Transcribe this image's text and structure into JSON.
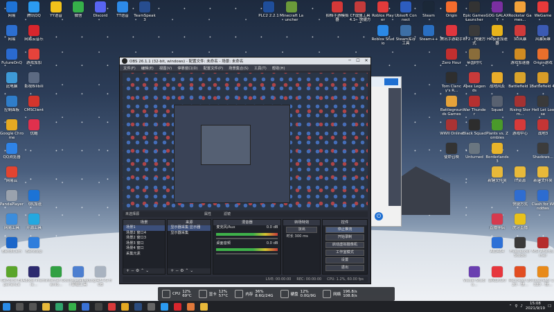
{
  "desktop_icons": [
    {
      "label": "网易",
      "icon": "n-icon",
      "color": "#1e73d6",
      "col": 0,
      "row": 0
    },
    {
      "label": "腾讯QQ",
      "icon": "qq-icon",
      "color": "#2b9bf1",
      "col": 1,
      "row": 0
    },
    {
      "label": "YY语音",
      "icon": "yy-icon",
      "color": "#f2c21b",
      "col": 2,
      "row": 0
    },
    {
      "label": "微信",
      "icon": "wechat-icon",
      "color": "#36b04a",
      "col": 3,
      "row": 0
    },
    {
      "label": "Discord",
      "icon": "discord-icon",
      "color": "#5865f2",
      "col": 4,
      "row": 0
    },
    {
      "label": "TT语音",
      "icon": "tt-icon",
      "color": "#2d8ae8",
      "col": 5,
      "row": 0
    },
    {
      "label": "TeamSpeak 3",
      "icon": "teamspeak-icon",
      "color": "#274d8f",
      "col": 6,
      "row": 0
    },
    {
      "label": "网易",
      "icon": "n-icon",
      "color": "#2c6fd1",
      "col": 0,
      "row": 1
    },
    {
      "label": "网易云音乐",
      "icon": "music-icon",
      "color": "#d8262d",
      "col": 1,
      "row": 1
    },
    {
      "label": "FutureOnQ",
      "icon": "network-icon",
      "color": "#2a6ad0",
      "col": 0,
      "row": 2
    },
    {
      "label": "游戏加加",
      "icon": "game-icon",
      "color": "#e6433b",
      "col": 1,
      "row": 2
    },
    {
      "label": "此电脑",
      "icon": "pc-icon",
      "color": "#3e9ad7",
      "col": 0,
      "row": 3
    },
    {
      "label": "影视Bilibili",
      "icon": "bili-icon",
      "color": "#5c6a82",
      "col": 1,
      "row": 3
    },
    {
      "label": "控制面板",
      "icon": "panel-icon",
      "color": "#2f7dc9",
      "col": 0,
      "row": 4
    },
    {
      "label": "CMSClient",
      "icon": "cms-icon",
      "color": "#d4352c",
      "col": 1,
      "row": 4
    },
    {
      "label": "Google Chrome",
      "icon": "chrome-icon",
      "color": "#e5a922",
      "col": 0,
      "row": 5
    },
    {
      "label": "优酷",
      "icon": "youku-icon",
      "color": "#e0304d",
      "col": 1,
      "row": 5
    },
    {
      "label": "QQ浏览器",
      "icon": "browser-icon",
      "color": "#2f83e6",
      "col": 0,
      "row": 6
    },
    {
      "label": "网易云",
      "icon": "cloud-icon",
      "color": "#e24430",
      "col": 0,
      "row": 7
    },
    {
      "label": "PandaPlayer",
      "icon": "panda-icon",
      "color": "#9aa2ad",
      "col": 0,
      "row": 8
    },
    {
      "label": "飞机加速",
      "icon": "plane-icon",
      "color": "#1c73d6",
      "col": 1,
      "row": 8
    },
    {
      "label": "网易工具",
      "icon": "tool-icon",
      "color": "#3c8ddc",
      "col": 0,
      "row": 9
    },
    {
      "label": "开源工具",
      "icon": "open-icon",
      "color": "#23a8e0",
      "col": 1,
      "row": 9
    },
    {
      "label": "BandiCam",
      "icon": "rec-icon",
      "color": "#1b66c9",
      "col": 0,
      "row": 10
    },
    {
      "label": "Bandizip",
      "icon": "zip-icon",
      "color": "#2f7edc",
      "col": 1,
      "row": 10
    },
    {
      "label": "GeForce Experience",
      "icon": "nvidia-icon",
      "color": "#5aa52a",
      "col": 0,
      "row": 11
    },
    {
      "label": "Adobe Premie...",
      "icon": "adobe-icon",
      "color": "#2c2a6e",
      "col": 1,
      "row": 11
    },
    {
      "label": "Internet Downlo...",
      "icon": "idm-icon",
      "color": "#31a043",
      "col": 2,
      "row": 11
    },
    {
      "label": "UninstallTool 卸载工具",
      "icon": "uninstall-icon",
      "color": "#4d7fd0",
      "col": 3,
      "row": 11
    },
    {
      "label": "Logi4FT-G HUB",
      "icon": "logi-icon",
      "color": "#a9b3c0",
      "col": 4,
      "row": 11
    },
    {
      "label": "PLC2 2.2.1",
      "icon": "plc-icon",
      "color": "#1f4e9a",
      "col": 10,
      "row": 0
    },
    {
      "label": "Minecraft Launcher",
      "icon": "minecraft-icon",
      "color": "#6b9a3a",
      "col": 11,
      "row": 0
    },
    {
      "label": "拍档手游模拟器",
      "icon": "emu-icon",
      "color": "#d43838",
      "col": 13,
      "row": 0
    },
    {
      "label": "CF战盟工具 4.1 - 快捷方式",
      "icon": "cf-icon",
      "color": "#c43b3b",
      "col": 14,
      "row": 0
    },
    {
      "label": "Roblox Player",
      "icon": "roblox-icon",
      "color": "#e23b3b",
      "col": 15,
      "row": 0
    },
    {
      "label": "Ubisoft Connect",
      "icon": "ubisoft-icon",
      "color": "#2d5dbf",
      "col": 16,
      "row": 0
    },
    {
      "label": "Steam",
      "icon": "steam-icon",
      "color": "#1b2838",
      "col": 17,
      "row": 0
    },
    {
      "label": "Origin",
      "icon": "origin-icon",
      "color": "#f56c2d",
      "col": 18,
      "row": 0
    },
    {
      "label": "Epic Games Launcher",
      "icon": "epic-icon",
      "color": "#333",
      "col": 19,
      "row": 0
    },
    {
      "label": "GOG GALAXY",
      "icon": "gog-icon",
      "color": "#7a2fa0",
      "col": 20,
      "row": 0
    },
    {
      "label": "Rockstar Games...",
      "icon": "rockstar-icon",
      "color": "#f2a23a",
      "col": 21,
      "row": 0
    },
    {
      "label": "WeGame",
      "icon": "wegame-icon",
      "color": "#e83a3a",
      "col": 22,
      "row": 0
    },
    {
      "label": "Roblox Studio",
      "icon": "rstudio-icon",
      "color": "#2b89e6",
      "col": 15,
      "row": 1
    },
    {
      "label": "Steam库存工具",
      "icon": "steam2-icon",
      "color": "#3d6fa5",
      "col": 16,
      "row": 1
    },
    {
      "label": "Steam++",
      "icon": "steampp-icon",
      "color": "#2a6fc1",
      "col": 17,
      "row": 1
    },
    {
      "label": "腾讯手游助手",
      "icon": "tencent-icon",
      "color": "#e0363e",
      "col": 18,
      "row": 1
    },
    {
      "label": "BF2 - 快捷方式",
      "icon": "bf2-icon",
      "color": "#3a3a3a",
      "col": 19,
      "row": 1
    },
    {
      "label": "HK极速加速器",
      "icon": "speed-icon",
      "color": "#e8b31a",
      "col": 20,
      "row": 1
    },
    {
      "label": "3D风暴",
      "icon": "storm-icon",
      "color": "#d03a3a",
      "col": 21,
      "row": 1
    },
    {
      "label": "风暴英雄",
      "icon": "hots-icon",
      "color": "#3b5ab3",
      "col": 22,
      "row": 1
    },
    {
      "label": "Zero Hour",
      "icon": "zh-icon",
      "color": "#c22f2f",
      "col": 18,
      "row": 2
    },
    {
      "label": "帝国时代",
      "icon": "aoe-icon",
      "color": "#8a6d3b",
      "col": 19,
      "row": 2
    },
    {
      "label": "游戏加速器",
      "icon": "acc-icon",
      "color": "#cf8b22",
      "col": 21,
      "row": 2
    },
    {
      "label": "Origin游戏",
      "icon": "origin2-icon",
      "color": "#ea6f2b",
      "col": 22,
      "row": 2
    },
    {
      "label": "Tom Clancy's R...",
      "icon": "r6-icon",
      "color": "#2e2e2e",
      "col": 18,
      "row": 3
    },
    {
      "label": "Apex Legends",
      "icon": "apex-icon",
      "color": "#c73a3a",
      "col": 19,
      "row": 3
    },
    {
      "label": "战地风云",
      "icon": "bf-icon",
      "color": "#e8ac2a",
      "col": 20,
      "row": 3
    },
    {
      "label": "Battlefield 1",
      "icon": "bf1-icon",
      "color": "#d9a32b",
      "col": 21,
      "row": 3
    },
    {
      "label": "Battlefield 4",
      "icon": "bf4-icon",
      "color": "#d89c27",
      "col": 22,
      "row": 3
    },
    {
      "label": "Battlegrounds Games",
      "icon": "pubg-icon",
      "color": "#e6a33a",
      "col": 18,
      "row": 4
    },
    {
      "label": "War Thunder",
      "icon": "wt-icon",
      "color": "#b53030",
      "col": 19,
      "row": 4
    },
    {
      "label": "Squad",
      "icon": "squad-icon",
      "color": "#586170",
      "col": 20,
      "row": 4
    },
    {
      "label": "Rising Storm...",
      "icon": "rs-icon",
      "color": "#a53232",
      "col": 21,
      "row": 4
    },
    {
      "label": "Hell Let Loose",
      "icon": "hll-icon",
      "color": "#3a3a3a",
      "col": 22,
      "row": 4
    },
    {
      "label": "WWII Online",
      "icon": "ww2-icon",
      "color": "#a33",
      "col": 18,
      "row": 5
    },
    {
      "label": "Black Squad",
      "icon": "bs-icon",
      "color": "#2d2d2d",
      "col": 19,
      "row": 5
    },
    {
      "label": "Plants vs. Zombies",
      "icon": "pvz-icon",
      "color": "#4a9a2a",
      "col": 20,
      "row": 5
    },
    {
      "label": "游戏中心",
      "icon": "center-icon",
      "color": "#d73a3a",
      "col": 21,
      "row": 5
    },
    {
      "label": "战地3",
      "icon": "bf3-icon",
      "color": "#c53535",
      "col": 22,
      "row": 5
    },
    {
      "label": "使命召唤",
      "icon": "cod-icon",
      "color": "#333",
      "col": 18,
      "row": 6
    },
    {
      "label": "Unturned",
      "icon": "unturned-icon",
      "color": "#6a7680",
      "col": 19,
      "row": 6
    },
    {
      "label": "Borderlands 3",
      "icon": "bl3-icon",
      "color": "#e8b42a",
      "col": 20,
      "row": 6
    },
    {
      "label": "Shadows...",
      "icon": "shadow-icon",
      "color": "#3c3c3c",
      "col": 22,
      "row": 6
    },
    {
      "label": "新建文件夹",
      "icon": "folder-icon",
      "color": "#e8b93a",
      "col": 20,
      "row": 7
    },
    {
      "label": "IT资源",
      "icon": "folder2-icon",
      "color": "#e8b93a",
      "col": 21,
      "row": 7
    },
    {
      "label": "新建文件夹",
      "icon": "folder3-icon",
      "color": "#e8b93a",
      "col": 22,
      "row": 7
    },
    {
      "label": "快捷方式",
      "icon": "shortcut-icon",
      "color": "#2f6dd1",
      "col": 21,
      "row": 8
    },
    {
      "label": "Clash for Windows",
      "icon": "clash-icon",
      "color": "#2d6cd0",
      "col": 22,
      "row": 8
    },
    {
      "label": "直播伴侣",
      "icon": "live-icon",
      "color": "#d63a4e",
      "col": 20,
      "row": 9
    },
    {
      "label": "虎牙直播",
      "icon": "huya-icon",
      "color": "#e8c11a",
      "col": 21,
      "row": 9
    },
    {
      "label": "AIDA64",
      "icon": "aida-icon",
      "color": "#2d70d6",
      "col": 20,
      "row": 10
    },
    {
      "label": "FiveLancer Studio",
      "icon": "fl-icon",
      "color": "#3a3a3a",
      "col": 21,
      "row": 10
    },
    {
      "label": "MSI Afterburner",
      "icon": "msi-icon",
      "color": "#b52c2c",
      "col": 22,
      "row": 10
    },
    {
      "label": "Visual Studio...",
      "icon": "vs-icon",
      "color": "#6a3fb0",
      "col": 19,
      "row": 11
    },
    {
      "label": "游戏2020",
      "icon": "game2-icon",
      "color": "#e6363d",
      "col": 20,
      "row": 11
    },
    {
      "label": "Microsoft 2020 - 快...",
      "icon": "ms-icon",
      "color": "#e14d22",
      "col": 21,
      "row": 11
    },
    {
      "label": "Illustrator 2020 - 快...",
      "icon": "ai-icon",
      "color": "#e88a1a",
      "col": 22,
      "row": 11
    }
  ],
  "obs": {
    "title": "OBS 26.1.1 (32-bit, windows) - 配置文件: 未命名 - 场景: 未命名",
    "menu": [
      "文件(F)",
      "编辑(E)",
      "视图(V)",
      "停靠窗口(D)",
      "配置文件(P)",
      "场景集合(S)",
      "工具(T)",
      "帮助(H)"
    ],
    "no_source": "未选择源",
    "properties": "属性",
    "filters": "滤镜",
    "docks": {
      "scenes": "场景",
      "sources": "来源",
      "mixer": "混音器",
      "transitions": "转场特效",
      "controls": "控件"
    },
    "scenes": [
      "场景1",
      "场景2 窗口4",
      "场景2 窗口3",
      "场景3 窗口",
      "场景4 窗口",
      "采集元素"
    ],
    "sources": [
      "显示器采集 显示器",
      "显示器采集"
    ],
    "mixer": [
      {
        "name": "麦克风/Aux",
        "level": "0.0 dB"
      },
      {
        "name": "桌面音频",
        "level": "0.0 dB"
      }
    ],
    "transition": {
      "type": "淡出",
      "duration_label": "时长",
      "duration": "300 ms"
    },
    "controls": [
      "停止推流",
      "开始录制",
      "启动虚拟摄像机",
      "工作室模式",
      "设置",
      "退出"
    ],
    "status": [
      "LIVE: 00:00:00",
      "REC: 00:00:00",
      "CPU: 1.2%, 60.00 fps"
    ]
  },
  "perf_widget": [
    {
      "name": "CPU",
      "icon": "cpu-icon",
      "l1": "12%",
      "l2": "69°C"
    },
    {
      "name": "显卡",
      "icon": "gpu-icon",
      "l1": "12%",
      "l2": "57°C"
    },
    {
      "name": "内存",
      "icon": "ram-icon",
      "l1": "36%",
      "l2": "8.6G/24G"
    },
    {
      "name": "硬盘",
      "icon": "disk-icon",
      "l1": "12%",
      "l2": "0.0G/9G"
    },
    {
      "name": "网络",
      "icon": "net-icon",
      "l1": "196.8/s",
      "l2": "108.8/s"
    }
  ],
  "taskbar": {
    "apps": [
      {
        "name": "windows-start-icon",
        "color": "#2a8ce8"
      },
      {
        "name": "search-icon",
        "color": "#555"
      },
      {
        "name": "taskview-icon",
        "color": "#555"
      },
      {
        "name": "explorer-icon",
        "color": "#e8b93a"
      },
      {
        "name": "edge-icon",
        "color": "#2fa36b"
      },
      {
        "name": "wechat-icon",
        "color": "#36b04a"
      },
      {
        "name": "store-icon",
        "color": "#3a72d6"
      },
      {
        "name": "obs-icon",
        "color": "#444"
      },
      {
        "name": "netease-icon",
        "color": "#d83a3a"
      },
      {
        "name": "chrome-icon",
        "color": "#e5a922"
      },
      {
        "name": "steam-icon",
        "color": "#2b4c7e"
      },
      {
        "name": "settings-icon",
        "color": "#666"
      },
      {
        "name": "qq-icon",
        "color": "#2b9bf1"
      },
      {
        "name": "music-icon",
        "color": "#d8262d"
      },
      {
        "name": "game-icon",
        "color": "#e0783a"
      },
      {
        "name": "folder-icon",
        "color": "#e8b93a"
      }
    ],
    "time": "15:08",
    "date": "2021/9/19"
  }
}
